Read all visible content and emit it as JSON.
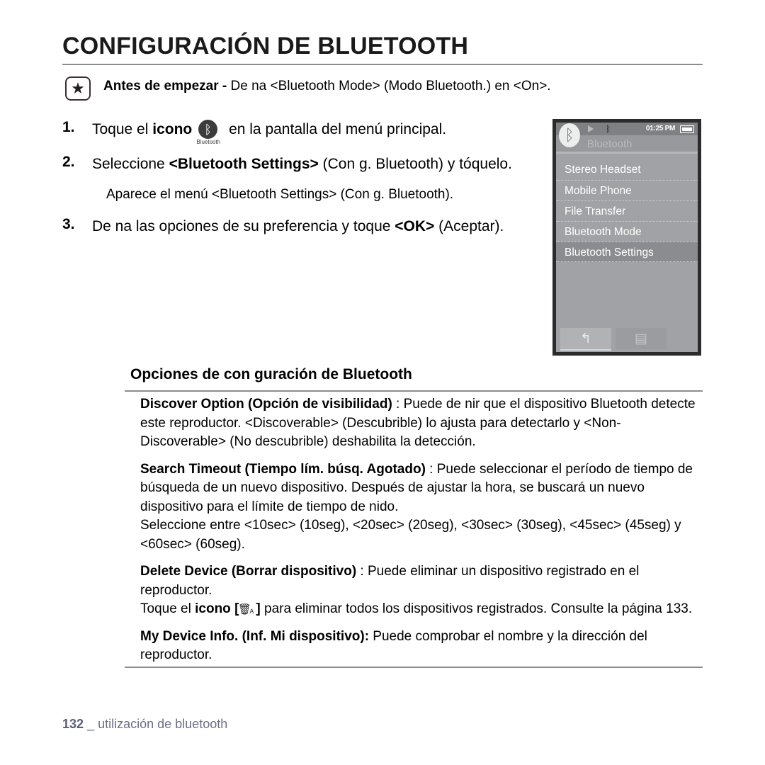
{
  "title": "CONFIGURACIÓN DE BLUETOOTH",
  "note": {
    "icon": "star-icon",
    "label": "Antes de empezar -",
    "text": " De na <Bluetooth Mode> (Modo Bluetooth.) en <On>."
  },
  "steps": [
    {
      "number": "1.",
      "text_before": "Toque el ",
      "bold_word": "icono",
      "icon_caption": "Bluetooth",
      "text_after": " en la pantalla del menú principal."
    },
    {
      "number": "2.",
      "text_before": "Seleccione ",
      "bold_word": "<Bluetooth Settings>",
      "text_after": " (Con g. Bluetooth) y tóquelo.",
      "substep": "Aparece el menú <Bluetooth Settings> (Con g. Bluetooth)."
    },
    {
      "number": "3.",
      "text_before": "De na las opciones de su preferencia y toque ",
      "bold_word": "<OK>",
      "text_after": " (Aceptar)."
    }
  ],
  "device": {
    "statusbar": {
      "play_icon": "play-icon",
      "bluetooth_icon": "bluetooth-icon",
      "time": "01:25 PM",
      "battery_icon": "battery-icon"
    },
    "screen_title": "Bluetooth",
    "logo_icon": "bluetooth-logo-icon",
    "menu_items": [
      {
        "label": "Stereo Headset",
        "selected": false
      },
      {
        "label": "Mobile Phone",
        "selected": false
      },
      {
        "label": "File Transfer",
        "selected": false
      },
      {
        "label": "Bluetooth Mode",
        "selected": false
      },
      {
        "label": "Bluetooth Settings",
        "selected": true
      }
    ],
    "softkeys": [
      {
        "name": "back-softkey",
        "icon": "back-arrow-icon",
        "glyph": "↰"
      },
      {
        "name": "menu-softkey",
        "icon": "list-menu-icon",
        "glyph": "▤"
      }
    ]
  },
  "options": {
    "heading": "Opciones de con guración de Bluetooth",
    "items": [
      {
        "term": "Discover Option (Opción de visibilidad)",
        "description": " : Puede de nir que el dispositivo Bluetooth detecte este reproductor. <Discoverable> (Descubrible) lo ajusta para detectarlo y <Non-Discoverable> (No descubrible) deshabilita la detección."
      },
      {
        "term": "Search Timeout (Tiempo lím. búsq. Agotado)",
        "description": " : Puede seleccionar el período de tiempo de búsqueda de un nuevo dispositivo. Después de ajustar la hora, se buscará un nuevo dispositivo para el límite de tiempo de nido.",
        "description_line2": "Seleccione entre <10sec> (10seg), <20sec> (20seg), <30sec> (30seg), <45sec> (45seg) y <60sec> (60seg)."
      },
      {
        "term": "Delete Device (Borrar dispositivo)",
        "description": " : Puede eliminar un dispositivo registrado en el reproductor.",
        "extra_before": "Toque el ",
        "extra_bold": "icono",
        "extra_bracket_open": " [",
        "trash_icon": "trash-can-icon",
        "trash_sub": "A",
        "extra_bracket_close": "] ",
        "extra_after": "para eliminar todos los dispositivos registrados. Consulte la página 133."
      },
      {
        "term": "My Device Info. (Inf. Mi dispositivo):",
        "description": " Puede comprobar el nombre y la dirección del reproductor."
      }
    ]
  },
  "footer": {
    "page_number": "132",
    "separator": "_",
    "section": "utilización de bluetooth"
  }
}
